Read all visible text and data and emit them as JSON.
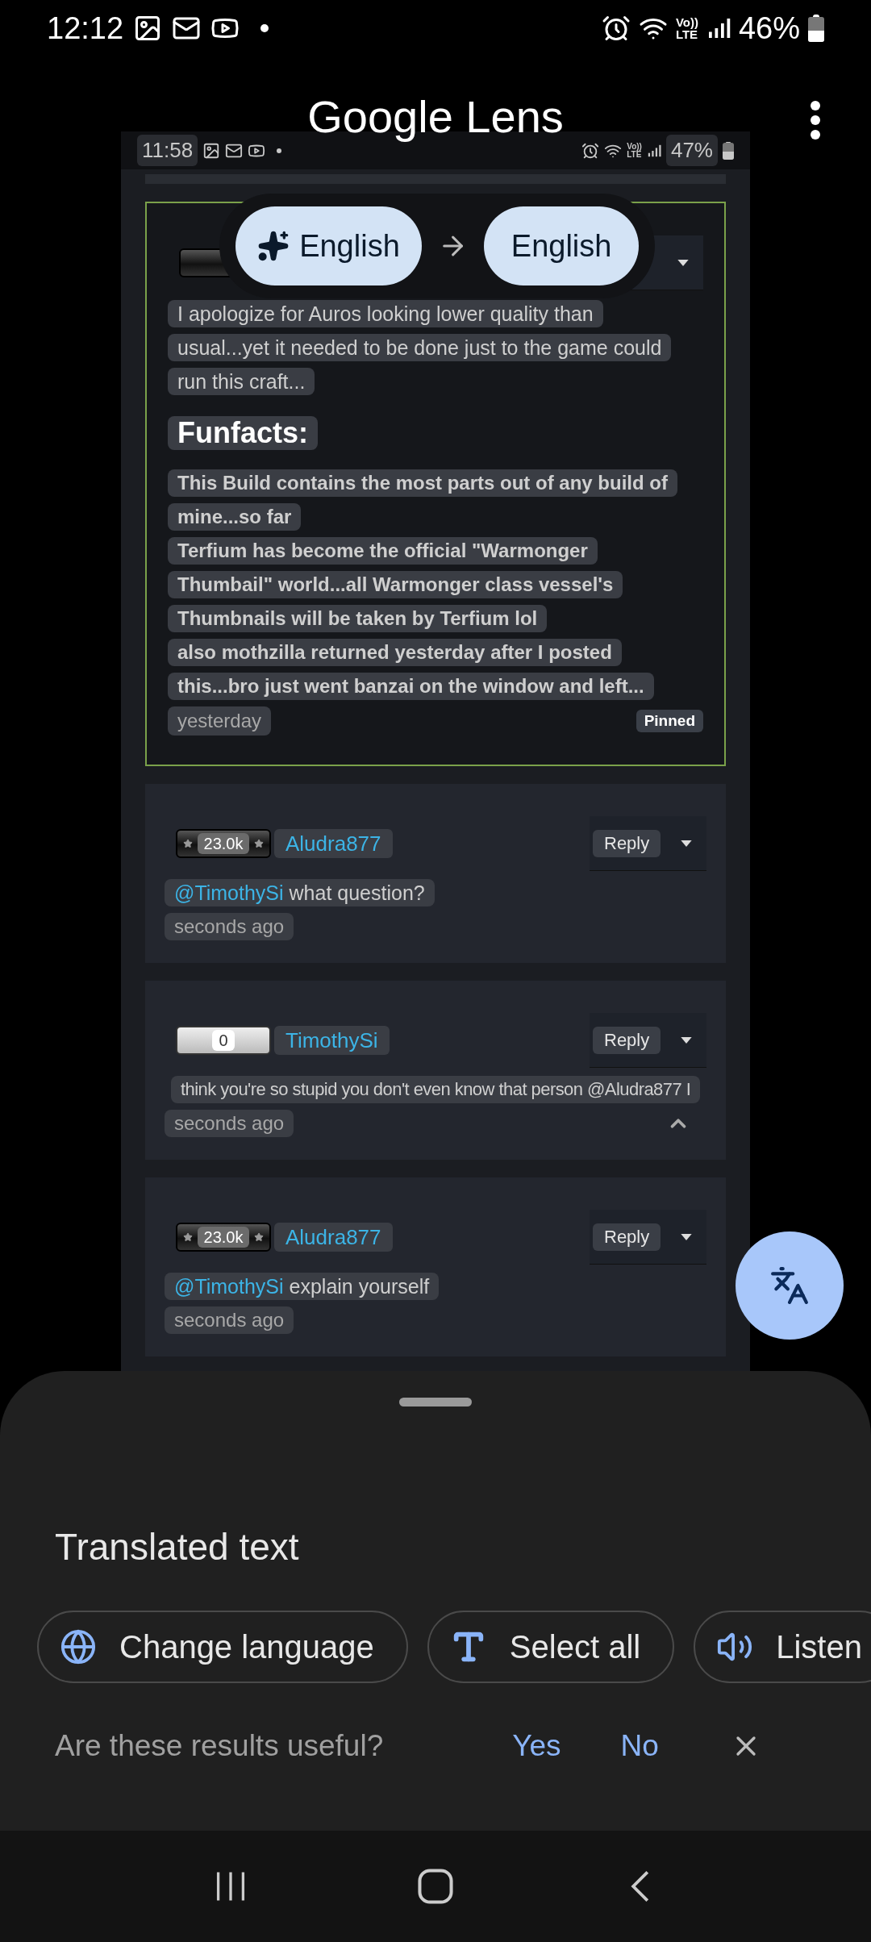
{
  "status_bar": {
    "time": "12:12",
    "volte": [
      "Vo))",
      "LTE"
    ],
    "battery": "46%"
  },
  "header": {
    "title": "Google Lens"
  },
  "screenshot": {
    "status_bar": {
      "time": "11:58",
      "volte": [
        "Vo))",
        "LTE"
      ],
      "battery": "47%"
    },
    "pinned_comment": {
      "lines": [
        "I apologize for Auros looking lower quality than",
        "usual...yet it needed to be done just to the game could",
        "run this craft..."
      ],
      "heading": "Funfacts:",
      "facts": [
        "This Build contains the most parts out of any build of",
        "mine...so far",
        "Terfium has become the official \"Warmonger",
        "Thumbail\" world...all Warmonger class vessel's",
        "Thumbnails will be taken by Terfium lol",
        "also mothzilla returned yesterday after I posted",
        "this...bro just went banzai on the window and left..."
      ],
      "time": "yesterday",
      "badge": "Pinned"
    },
    "comments": [
      {
        "rank": "23.0k",
        "kind": "dark",
        "user": "Aludra877",
        "reply": "Reply",
        "mention": "@TimothySi",
        "text": "what question?",
        "time": "seconds ago",
        "collapse_toggle": false
      },
      {
        "rank": "0",
        "kind": "light",
        "user": "TimothySi",
        "reply": "Reply",
        "text": "think you're so stupid you don't even know that person @Aludra877 I",
        "time": "seconds ago",
        "collapse_toggle": true
      },
      {
        "rank": "23.0k",
        "kind": "dark",
        "user": "Aludra877",
        "reply": "Reply",
        "mention": "@TimothySi",
        "text": "explain yourself",
        "time": "seconds ago",
        "collapse_toggle": false
      }
    ]
  },
  "language_bar": {
    "source": "English",
    "target": "English"
  },
  "sheet": {
    "title": "Translated text",
    "chips": [
      {
        "label": "Change language",
        "kind": "globe"
      },
      {
        "label": "Select all",
        "kind": "text"
      },
      {
        "label": "Listen",
        "kind": "speaker"
      }
    ],
    "feedback": {
      "question": "Are these results useful?",
      "yes": "Yes",
      "no": "No"
    }
  }
}
